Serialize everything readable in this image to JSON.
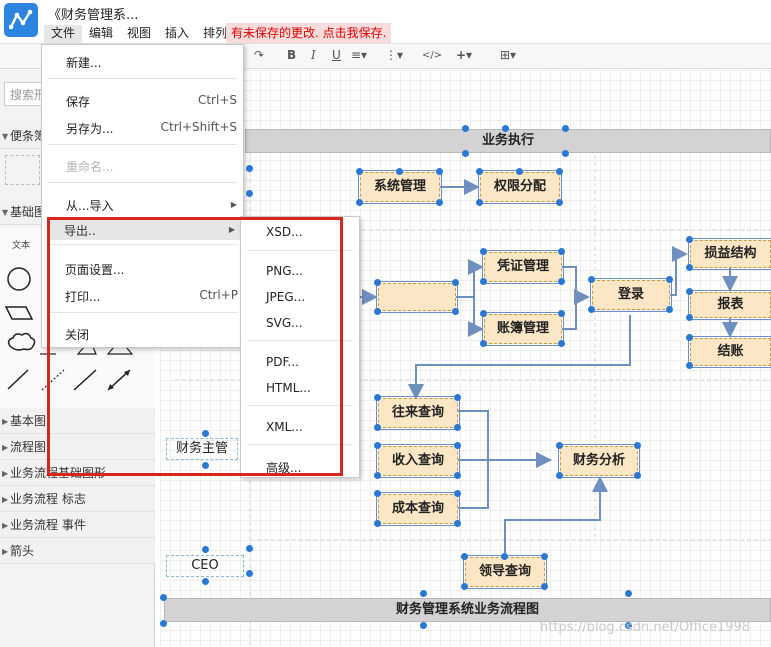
{
  "app": {
    "title": "《财务管理系..."
  },
  "menubar": [
    "文件",
    "编辑",
    "视图",
    "插入",
    "排列"
  ],
  "unsaved_notice": "有未保存的更改. 点击我保存.",
  "search": {
    "placeholder": "搜索形"
  },
  "sidebar": {
    "scratchpad": "便条簿",
    "general": "基础图",
    "shape_caption": "文本",
    "sections": [
      "基本图",
      "流程图",
      "业务流程基础图形",
      "业务流程 标志",
      "业务流程 事件",
      "箭头"
    ]
  },
  "file_menu": {
    "items": [
      {
        "label": "新建...",
        "shortcut": ""
      },
      {
        "label": "保存",
        "shortcut": "Ctrl+S"
      },
      {
        "label": "另存为...",
        "shortcut": "Ctrl+Shift+S"
      },
      {
        "label": "重命名...",
        "shortcut": "",
        "disabled": true
      },
      {
        "label": "从...导入",
        "shortcut": "",
        "submenu": true
      },
      {
        "label": "导出..",
        "shortcut": "",
        "submenu": true
      },
      {
        "label": "页面设置...",
        "shortcut": ""
      },
      {
        "label": "打印...",
        "shortcut": "Ctrl+P"
      },
      {
        "label": "关闭",
        "shortcut": ""
      }
    ]
  },
  "export_menu": [
    "XSD...",
    "PNG...",
    "JPEG...",
    "SVG...",
    "PDF...",
    "HTML...",
    "XML...",
    "高级..."
  ],
  "diagram": {
    "lane_business": "业务执行",
    "system_mgmt": "系统管理",
    "permission": "权限分配",
    "voucher": "凭证管理",
    "ledger": "账簿管理",
    "login": "登录",
    "pnl": "损益结构",
    "report": "报表",
    "closing": "结账",
    "finance_lead": "财务主管",
    "ar_query": "往来查询",
    "income_query": "收入查询",
    "cost_query": "成本查询",
    "finance_analysis": "财务分析",
    "ceo": "CEO",
    "leader_query": "领导查询",
    "footer_title": "财务管理系统业务流程图"
  },
  "watermark": "https://blog.csdn.net/Office1998",
  "colors": {
    "accent": "#2b78d4",
    "highlight": "#d9261c",
    "shape_fill": "#fbe7c6"
  }
}
